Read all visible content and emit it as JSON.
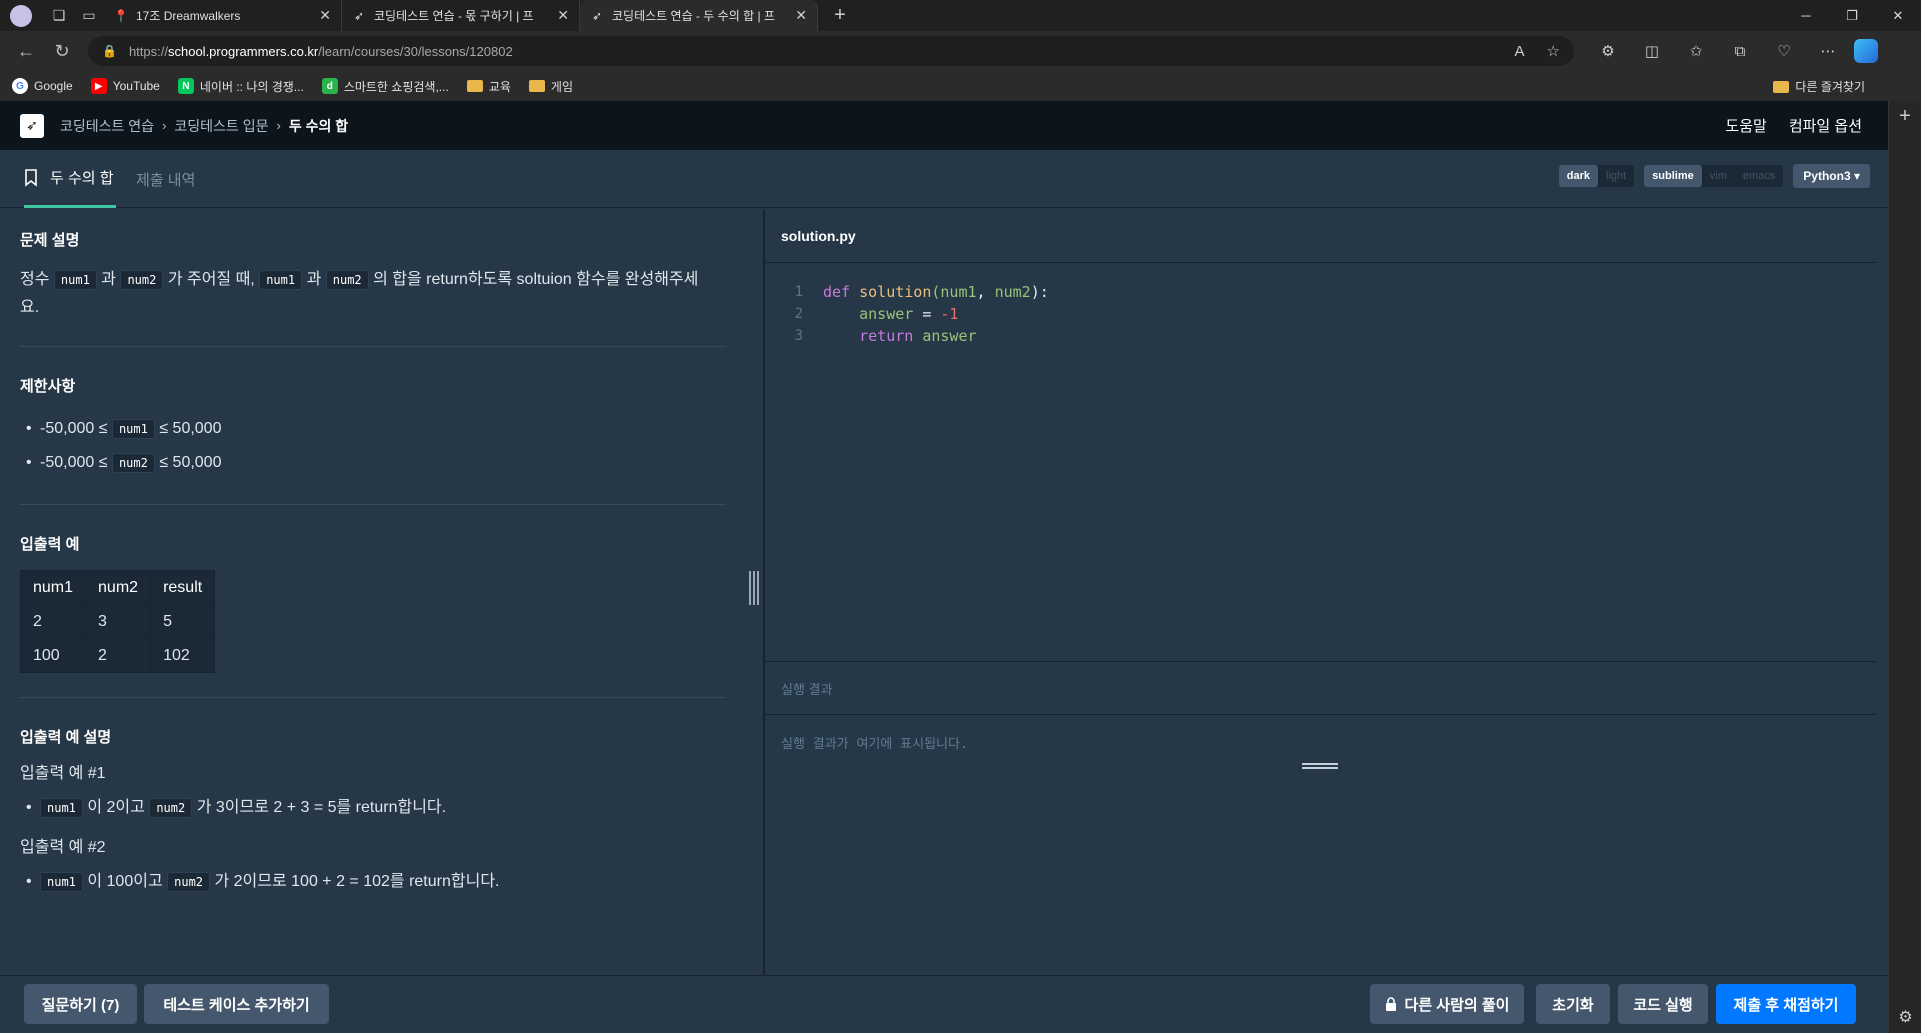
{
  "browser": {
    "tabs": [
      {
        "title": "17조 Dreamwalkers"
      },
      {
        "title": "코딩테스트 연습 - 몫 구하기 | 프"
      },
      {
        "title": "코딩테스트 연습 - 두 수의 합 | 프"
      }
    ],
    "url_prefix": "https://",
    "url_host": "school.programmers.co.kr",
    "url_path": "/learn/courses/30/lessons/120802",
    "bookmarks": [
      "Google",
      "YouTube",
      "네이버 :: 나의 경쟁...",
      "스마트한 쇼핑검색,...",
      "교육",
      "게임"
    ],
    "other_bookmarks": "다른 즐겨찾기"
  },
  "app": {
    "breadcrumb": [
      "코딩테스트 연습",
      "코딩테스트 입문",
      "두 수의 합"
    ],
    "header_links": [
      "도움말",
      "컴파일 옵션"
    ],
    "tabs": [
      "두 수의 합",
      "제출 내역"
    ],
    "themes": [
      "dark",
      "light"
    ],
    "keymaps": [
      "sublime",
      "vim",
      "emacs"
    ],
    "language": "Python3"
  },
  "problem": {
    "desc_title": "문제 설명",
    "desc": {
      "t1": "정수",
      "c1": "num1",
      "t2": "과",
      "c2": "num2",
      "t3": "가 주어질 때,",
      "c3": "num1",
      "t4": "과",
      "c4": "num2",
      "t5": "의 합을 return하도록 soltuion 함수를 완성해주세",
      "t6": "요."
    },
    "constraints_title": "제한사항",
    "constraints": [
      {
        "pre": "-50,000 ≤",
        "code": "num1",
        "post": "≤ 50,000"
      },
      {
        "pre": "-50,000 ≤",
        "code": "num2",
        "post": "≤ 50,000"
      }
    ],
    "io_title": "입출력 예",
    "io_headers": [
      "num1",
      "num2",
      "result"
    ],
    "io_rows": [
      [
        "2",
        "3",
        "5"
      ],
      [
        "100",
        "2",
        "102"
      ]
    ],
    "explain_title": "입출력 예 설명",
    "ex1_title": "입출력 예 #1",
    "ex1": {
      "c1": "num1",
      "t1": "이 2이고",
      "c2": "num2",
      "t2": "가 3이므로 2 + 3 = 5를 return합니다."
    },
    "ex2_title": "입출력 예 #2",
    "ex2": {
      "c1": "num1",
      "t1": "이 100이고",
      "c2": "num2",
      "t2": "가 2이므로 100 + 2 = 102를 return합니다."
    }
  },
  "editor": {
    "filename": "solution.py",
    "line_numbers": [
      "1",
      "2",
      "3"
    ],
    "tokens": {
      "def": "def",
      "fname": "solution",
      "p1": "num1",
      "p2": "num2",
      "answer": "answer",
      "eq": " = ",
      "neg": "-1",
      "ret": "return",
      "ret_var": "answer"
    },
    "result_title": "실행 결과",
    "result_placeholder": "실행 결과가 여기에 표시됩니다."
  },
  "footer": {
    "question": "질문하기 (7)",
    "add_testcase": "테스트 케이스 추가하기",
    "others": "다른 사람의 풀이",
    "reset": "초기화",
    "run": "코드 실행",
    "submit": "제출 후 채점하기"
  },
  "colors": {
    "accent_green": "#44c4a1",
    "primary_blue": "#0078ff",
    "bg_dark": "#263747",
    "header_dark": "#0c151c"
  }
}
